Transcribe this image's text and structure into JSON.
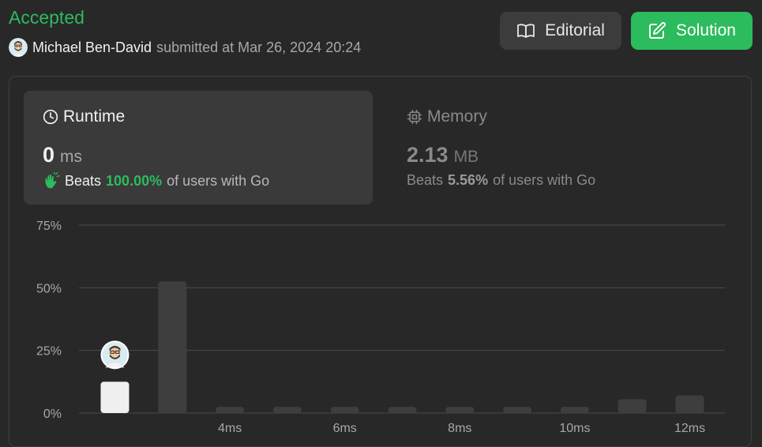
{
  "submission": {
    "status": "Accepted",
    "user": "Michael Ben-David",
    "submitted_text": "submitted at Mar 26, 2024 20:24"
  },
  "buttons": {
    "editorial": "Editorial",
    "solution": "Solution"
  },
  "runtime": {
    "label": "Runtime",
    "value": "0",
    "unit": "ms",
    "beats_prefix": "Beats",
    "beats_pct": "100.00%",
    "beats_suffix": "of users with Go"
  },
  "memory": {
    "label": "Memory",
    "value": "2.13",
    "unit": "MB",
    "beats_prefix": "Beats",
    "beats_pct": "5.56%",
    "beats_suffix": "of users with Go"
  },
  "colors": {
    "accent_green": "#2cbb5d",
    "bar_default": "#3e3e3e",
    "bar_user": "#f0f0f0",
    "background": "#282828"
  },
  "chart_data": {
    "type": "bar",
    "x_tick_labels": [
      "4ms",
      "6ms",
      "8ms",
      "10ms",
      "12ms"
    ],
    "y_tick_labels": [
      "0%",
      "25%",
      "50%",
      "75%"
    ],
    "ylim": [
      0,
      75
    ],
    "x": [
      0,
      1,
      2,
      3,
      4,
      5,
      6,
      7,
      8,
      9,
      10
    ],
    "values": [
      12.5,
      52.5,
      2.5,
      2.5,
      2.5,
      2.5,
      2.5,
      2.5,
      2.5,
      5.5,
      7
    ],
    "highlight_index": 0,
    "grid": true
  }
}
